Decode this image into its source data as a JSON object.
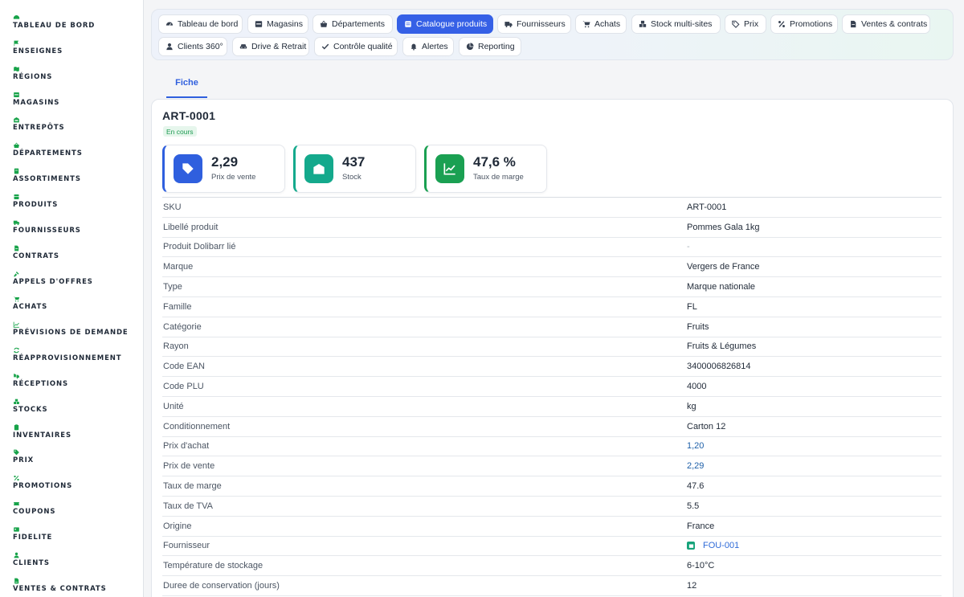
{
  "sidebar": {
    "items": [
      {
        "label": "TABLEAU DE BORD",
        "icon": "dashboard-icon"
      },
      {
        "label": "ENSEIGNES",
        "icon": "flag-icon"
      },
      {
        "label": "RÉGIONS",
        "icon": "map-icon"
      },
      {
        "label": "MAGASINS",
        "icon": "store-icon"
      },
      {
        "label": "ENTREPÔTS",
        "icon": "warehouse-icon"
      },
      {
        "label": "DÉPARTEMENTS",
        "icon": "basket-icon"
      },
      {
        "label": "ASSORTIMENTS",
        "icon": "list-icon"
      },
      {
        "label": "PRODUITS",
        "icon": "box-icon"
      },
      {
        "label": "FOURNISSEURS",
        "icon": "truck-icon"
      },
      {
        "label": "CONTRATS",
        "icon": "file-icon"
      },
      {
        "label": "APPELS D'OFFRES",
        "icon": "gavel-icon"
      },
      {
        "label": "ACHATS",
        "icon": "cart-icon"
      },
      {
        "label": "PRÉVISIONS DE DEMANDE",
        "icon": "chart-line-icon"
      },
      {
        "label": "RÉAPPROVISIONNEMENT",
        "icon": "refresh-icon"
      },
      {
        "label": "RÉCEPTIONS",
        "icon": "truck-loading-icon"
      },
      {
        "label": "STOCKS",
        "icon": "boxes-icon"
      },
      {
        "label": "INVENTAIRES",
        "icon": "clipboard-icon"
      },
      {
        "label": "PRIX",
        "icon": "tag-icon"
      },
      {
        "label": "PROMOTIONS",
        "icon": "percent-icon"
      },
      {
        "label": "COUPONS",
        "icon": "ticket-icon"
      },
      {
        "label": "FIDELITE",
        "icon": "id-card-icon"
      },
      {
        "label": "CLIENTS",
        "icon": "user-icon"
      },
      {
        "label": "VENTES & CONTRATS",
        "icon": "file-contract-icon"
      }
    ]
  },
  "topnav": {
    "items": [
      {
        "label": "Tableau de bord",
        "icon": "gauge-icon"
      },
      {
        "label": "Magasins",
        "icon": "store-icon"
      },
      {
        "label": "Départements",
        "icon": "basket-icon"
      },
      {
        "label": "Catalogue produits",
        "icon": "catalog-icon",
        "active": true
      },
      {
        "label": "Fournisseurs",
        "icon": "truck-icon"
      },
      {
        "label": "Achats",
        "icon": "cart-icon"
      },
      {
        "label": "Stock multi-sites",
        "icon": "boxes-icon"
      },
      {
        "label": "Prix",
        "icon": "tags-icon"
      },
      {
        "label": "Promotions",
        "icon": "percent-icon"
      },
      {
        "label": "Ventes & contrats",
        "icon": "file-icon"
      },
      {
        "label": "Clients 360°",
        "icon": "user-icon"
      },
      {
        "label": "Drive & Retrait",
        "icon": "car-icon"
      },
      {
        "label": "Contrôle qualité",
        "icon": "check-icon"
      },
      {
        "label": "Alertes",
        "icon": "bell-icon"
      },
      {
        "label": "Reporting",
        "icon": "pie-chart-icon"
      }
    ]
  },
  "tab": {
    "label": "Fiche"
  },
  "product": {
    "title": "ART-0001",
    "status": "En cours"
  },
  "kpis": [
    {
      "value": "2,29",
      "label": "Prix de vente",
      "icon": "tag-icon",
      "color": "#2f5fde"
    },
    {
      "value": "437",
      "label": "Stock",
      "icon": "warehouse-icon",
      "color": "#14a98c"
    },
    {
      "value": "47,6 %",
      "label": "Taux de marge",
      "icon": "chart-line-icon",
      "color": "#1aa052"
    }
  ],
  "fields": [
    {
      "key": "SKU",
      "value": "ART-0001"
    },
    {
      "key": "Libellé produit",
      "value": "Pommes Gala 1kg"
    },
    {
      "key": "Produit Dolibarr lié",
      "value": "-",
      "style": "muted"
    },
    {
      "key": "Marque",
      "value": "Vergers de France"
    },
    {
      "key": "Type",
      "value": "Marque nationale"
    },
    {
      "key": "Famille",
      "value": "FL"
    },
    {
      "key": "Catégorie",
      "value": "Fruits"
    },
    {
      "key": "Rayon",
      "value": "Fruits & Légumes"
    },
    {
      "key": "Code EAN",
      "value": "3400006826814"
    },
    {
      "key": "Code PLU",
      "value": "4000"
    },
    {
      "key": "Unité",
      "value": "kg"
    },
    {
      "key": "Conditionnement",
      "value": "Carton 12"
    },
    {
      "key": "Prix d'achat",
      "value": "1,20",
      "style": "link"
    },
    {
      "key": "Prix de vente",
      "value": "2,29",
      "style": "link"
    },
    {
      "key": "Taux de marge",
      "value": "47.6"
    },
    {
      "key": "Taux de TVA",
      "value": "5.5"
    },
    {
      "key": "Origine",
      "value": "France"
    },
    {
      "key": "Fournisseur",
      "value": "FOU-001",
      "style": "fou"
    },
    {
      "key": "Température de stockage",
      "value": "6-10°C"
    },
    {
      "key": "Duree de conservation (jours)",
      "value": "12"
    }
  ]
}
